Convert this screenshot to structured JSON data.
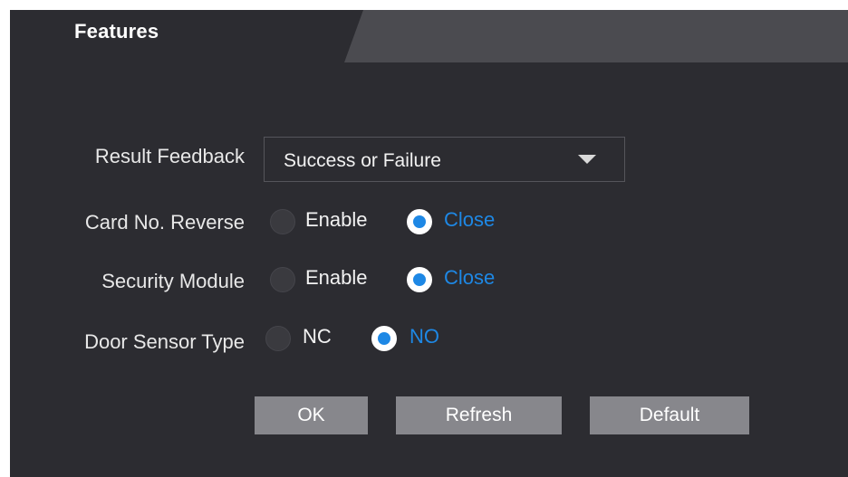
{
  "header": {
    "title": "Features"
  },
  "form": {
    "result_feedback": {
      "label": "Result Feedback",
      "value": "Success or Failure"
    },
    "card_no_reverse": {
      "label": "Card No. Reverse",
      "options": [
        "Enable",
        "Close"
      ],
      "selected": "Close"
    },
    "security_module": {
      "label": "Security Module",
      "options": [
        "Enable",
        "Close"
      ],
      "selected": "Close"
    },
    "door_sensor_type": {
      "label": "Door Sensor Type",
      "options": [
        "NC",
        "NO"
      ],
      "selected": "NO"
    }
  },
  "buttons": {
    "ok": "OK",
    "refresh": "Refresh",
    "default": "Default"
  },
  "colors": {
    "accent": "#1e88e5",
    "panel_bg": "#2c2c31",
    "button_bg": "#87878c"
  }
}
